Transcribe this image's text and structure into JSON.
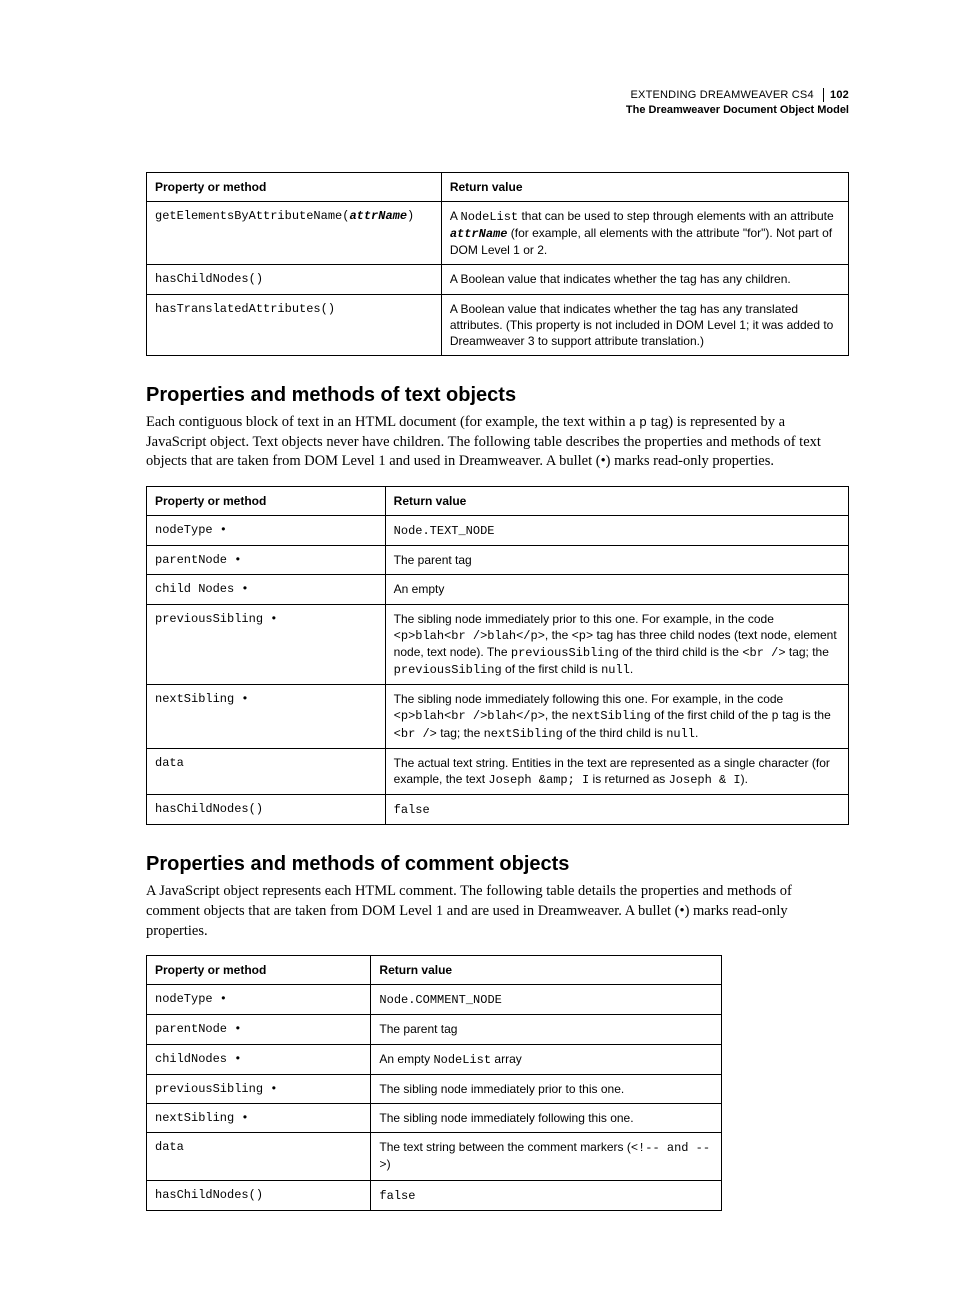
{
  "header": {
    "title": "EXTENDING DREAMWEAVER CS4",
    "pagenum": "102",
    "subtitle": "The Dreamweaver Document Object Model"
  },
  "table1": {
    "h1": "Property or method",
    "h2": "Return value",
    "r1c1a": "getElementsByAttributeName(",
    "r1c1b": "attrName",
    "r1c1c": ")",
    "r1c2a": "A ",
    "r1c2b": "NodeList",
    "r1c2c": " that can be used to step through elements with an attribute ",
    "r1c2d": "attrName",
    "r1c2e": " (for example, all elements with the attribute \"for\"). Not part of DOM Level 1 or 2.",
    "r2c1": "hasChildNodes()",
    "r2c2": "A Boolean value that indicates whether the tag has any children.",
    "r3c1": "hasTranslatedAttributes()",
    "r3c2": "A Boolean value that indicates whether the tag has any translated attributes. (This property is not included in DOM Level 1; it was added to Dreamweaver 3 to support attribute translation.)"
  },
  "section2": {
    "heading": "Properties and methods of text objects",
    "para_a": "Each contiguous block of text in an HTML document (for example, the text within a ",
    "para_b": "p",
    "para_c": " tag) is represented by a JavaScript object. Text objects never have children. The following table describes the properties and methods of text objects that are taken from DOM Level 1 and used in Dreamweaver. A bullet (•) marks read-only properties."
  },
  "table2": {
    "h1": "Property or method",
    "h2": "Return value",
    "r1c1": "nodeType •",
    "r1c2": "Node.TEXT_NODE",
    "r2c1": "parentNode •",
    "r2c2": "The parent tag",
    "r3c1": "child Nodes •",
    "r3c2": "An empty",
    "r4c1": "previousSibling •",
    "r4c2a": "The sibling node immediately prior to this one. For example, in the code ",
    "r4c2b": "<p>blah<br />blah</p>",
    "r4c2c": ", the ",
    "r4c2d": "<p>",
    "r4c2e": " tag has three child nodes (text node, element node, text node). The ",
    "r4c2f": "previousSibling",
    "r4c2g": " of the third child is the ",
    "r4c2h": "<br />",
    "r4c2i": " tag; the ",
    "r4c2j": "previousSibling",
    "r4c2k": " of the first child is ",
    "r4c2l": "null",
    "r4c2m": ".",
    "r5c1": "nextSibling •",
    "r5c2a": "The sibling node immediately following this one. For example, in the code ",
    "r5c2b": "<p>blah<br />blah</p>",
    "r5c2c": ", the ",
    "r5c2d": "nextSibling",
    "r5c2e": " of the first child of the ",
    "r5c2f": "p",
    "r5c2g": " tag is the ",
    "r5c2h": "<br />",
    "r5c2i": " tag; the ",
    "r5c2j": "nextSibling",
    "r5c2k": " of the third child is ",
    "r5c2l": "null",
    "r5c2m": ".",
    "r6c1": "data",
    "r6c2a": "The actual text string. Entities in the text are represented as a single character (for example, the text ",
    "r6c2b": "Joseph &amp; I",
    "r6c2c": " is returned as ",
    "r6c2d": "Joseph & I",
    "r6c2e": ").",
    "r7c1": "hasChildNodes()",
    "r7c2": "false"
  },
  "section3": {
    "heading": "Properties and methods of comment objects",
    "para": "A JavaScript object represents each HTML comment. The following table details the properties and methods of comment objects that are taken from DOM Level 1 and are used in Dreamweaver. A bullet (•) marks read-only properties."
  },
  "table3": {
    "h1": "Property or method",
    "h2": "Return value",
    "r1c1": "nodeType •",
    "r1c2": "Node.COMMENT_NODE",
    "r2c1": "parentNode •",
    "r2c2": "The parent tag",
    "r3c1": "childNodes •",
    "r3c2a": "An empty ",
    "r3c2b": "NodeList",
    "r3c2c": " array",
    "r4c1": "previousSibling •",
    "r4c2": "The sibling node immediately prior to this one.",
    "r5c1": "nextSibling •",
    "r5c2": "The sibling node immediately following this one.",
    "r6c1": "data",
    "r6c2a": "The text string between the comment markers (",
    "r6c2b": "<!-- and -->",
    "r6c2c": ")",
    "r7c1": "hasChildNodes()",
    "r7c2": "false"
  }
}
